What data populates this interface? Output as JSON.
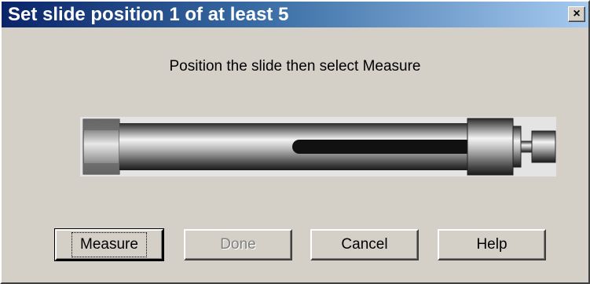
{
  "window": {
    "title": "Set slide position 1 of at least 5",
    "close_glyph": "×"
  },
  "dialog": {
    "instruction": "Position the slide then select Measure"
  },
  "buttons": {
    "measure": "Measure",
    "done": "Done",
    "cancel": "Cancel",
    "help": "Help"
  },
  "slide": {
    "image": "coaxial-sliding-load-graphic"
  }
}
